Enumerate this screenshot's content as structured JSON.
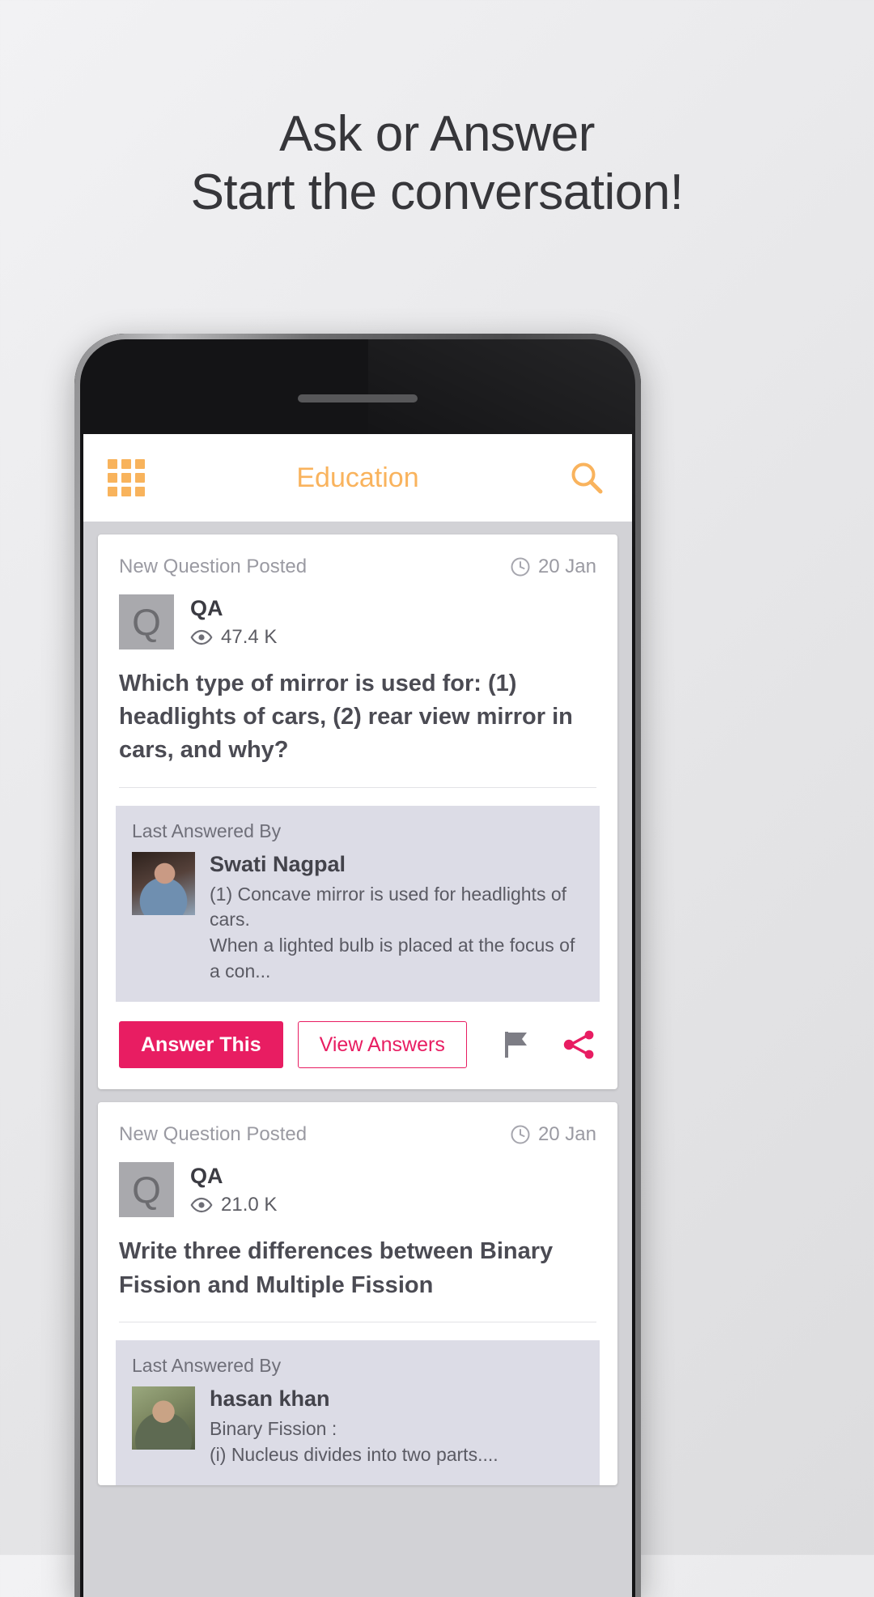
{
  "promo": {
    "line1": "Ask or Answer",
    "line2": "Start the conversation!"
  },
  "colors": {
    "accent_orange": "#F9B35D",
    "accent_pink": "#E81D62",
    "answer_box_bg": "#DCDCE6",
    "muted_text": "#9A9AA2"
  },
  "app": {
    "header": {
      "title": "Education",
      "grid_icon": "grid-menu-icon",
      "search_icon": "search-icon"
    },
    "cards": [
      {
        "posted_label": "New Question Posted",
        "date": "20 Jan",
        "date_icon": "clock-icon",
        "asker_initials": "Q",
        "asker_name": "QA",
        "views_icon": "eye-icon",
        "views": "47.4 K",
        "question": "Which type of mirror is used for: (1) headlights of cars, (2) rear view mirror in cars, and why?",
        "answer": {
          "label": "Last Answered By",
          "author": "Swati Nagpal",
          "snippet": "(1) Concave mirror is used for headlights of cars.\nWhen a lighted bulb is placed at the focus of a con..."
        },
        "buttons": {
          "answer_this": "Answer This",
          "view_answers": "View Answers"
        },
        "icons": {
          "flag": "flag-icon",
          "share": "share-icon"
        }
      },
      {
        "posted_label": "New Question Posted",
        "date": "20 Jan",
        "date_icon": "clock-icon",
        "asker_initials": "Q",
        "asker_name": "QA",
        "views_icon": "eye-icon",
        "views": "21.0 K",
        "question": "Write three differences between Binary Fission and Multiple Fission",
        "answer": {
          "label": "Last Answered By",
          "author": "hasan khan",
          "snippet": "Binary Fission :\n(i) Nucleus divides into two parts...."
        }
      }
    ]
  }
}
